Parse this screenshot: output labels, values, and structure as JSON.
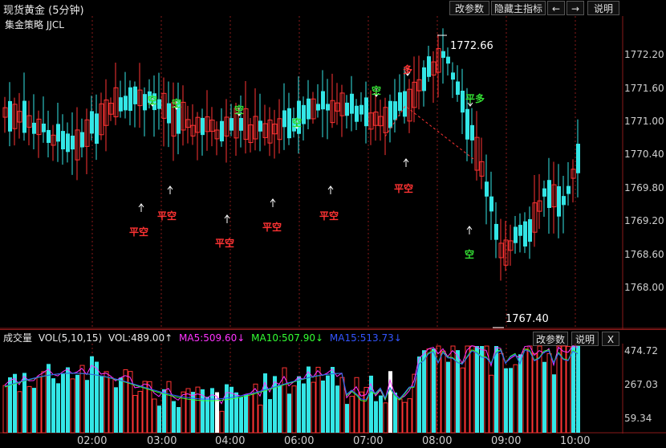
{
  "header": {
    "title": "现货黄金 (5分钟)",
    "strategy": "集金策略 JJCL",
    "btn_edit": "改参数",
    "btn_hide": "隐藏主指标",
    "btn_left": "←",
    "btn_right": "→",
    "btn_help": "说明"
  },
  "price_axis": [
    "1772.20",
    "1771.60",
    "1771.00",
    "1770.40",
    "1769.80",
    "1769.20",
    "1768.60",
    "1768.00"
  ],
  "annotations": {
    "high": "1772.66",
    "low": "1767.40"
  },
  "signals": [
    {
      "text": "空",
      "color": "#33dd33"
    },
    {
      "text": "空",
      "color": "#33dd33"
    },
    {
      "text": "空",
      "color": "#33dd33"
    },
    {
      "text": "空",
      "color": "#33dd33"
    },
    {
      "text": "空",
      "color": "#33dd33"
    },
    {
      "text": "多",
      "color": "#ff3333"
    },
    {
      "text": "平多",
      "color": "#33dd33"
    },
    {
      "text": "空",
      "color": "#33dd33"
    },
    {
      "text": "平空",
      "color": "#ff3333"
    },
    {
      "text": "平空",
      "color": "#ff3333"
    },
    {
      "text": "平空",
      "color": "#ff3333"
    },
    {
      "text": "平空",
      "color": "#ff3333"
    },
    {
      "text": "平空",
      "color": "#ff3333"
    },
    {
      "text": "平空",
      "color": "#ff3333"
    }
  ],
  "volume": {
    "label": "成交量",
    "params": "VOL(5,10,15)",
    "vol": "VOL:489.00↑",
    "ma5": "MA5:509.60↓",
    "ma10": "MA10:507.90↓",
    "ma15": "MA15:513.73↓",
    "btn_edit": "改参数",
    "btn_help": "说明",
    "btn_close": "X",
    "axis": [
      "474.72",
      "267.03",
      "59.34"
    ]
  },
  "time_axis": [
    "02:00",
    "03:00",
    "04:00",
    "06:00",
    "07:00",
    "08:00",
    "09:00",
    "10:00"
  ],
  "colors": {
    "up": "#ff3333",
    "down": "#33e6e6",
    "grid": "#8a1a1a",
    "ma5": "#ff33ff",
    "ma10": "#33ff33",
    "ma15": "#3355ff"
  }
}
